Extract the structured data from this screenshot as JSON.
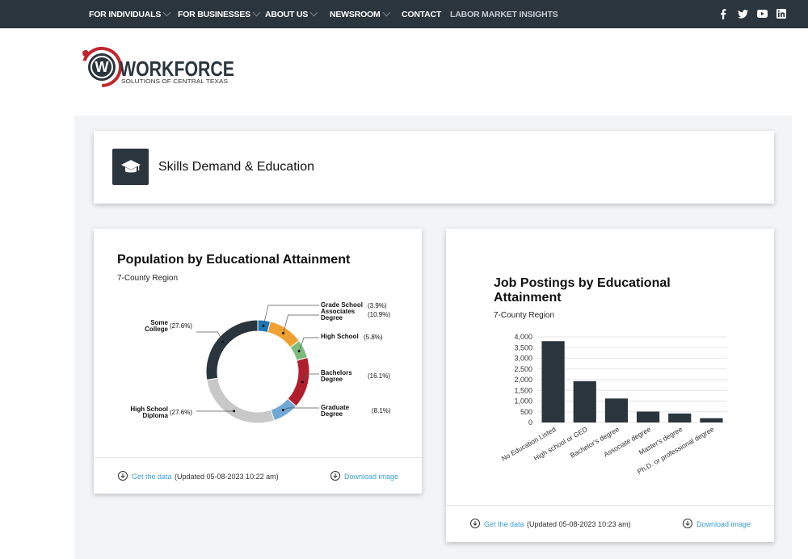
{
  "nav": {
    "items": [
      {
        "label": "FOR INDIVIDUALS",
        "has_dropdown": true
      },
      {
        "label": "FOR BUSINESSES",
        "has_dropdown": true
      },
      {
        "label": "ABOUT US",
        "has_dropdown": true
      },
      {
        "label": "NEWSROOM",
        "has_dropdown": true
      },
      {
        "label": "CONTACT",
        "has_dropdown": false
      },
      {
        "label": "LABOR MARKET INSIGHTS",
        "has_dropdown": false
      }
    ],
    "social_icons": [
      "facebook-icon",
      "twitter-icon",
      "youtube-icon",
      "linkedin-icon"
    ],
    "background": "#2b353d"
  },
  "logo": {
    "wordmark": "WORKFORCE",
    "tagline": "SOLUTIONS OF CENTRAL TEXAS",
    "accent_color": "#c1272d"
  },
  "section": {
    "title": "Skills Demand & Education",
    "icon": "graduation-cap-icon"
  },
  "population_chart": {
    "title": "Population by Educational Attainment",
    "subtitle": "7-County Region",
    "footer": {
      "get_data": "Get the data",
      "updated": "(Updated 05-08-2023 10:22 am)",
      "download": "Download image"
    }
  },
  "jobs_chart": {
    "title": "Job Postings by Educational Attainment",
    "subtitle": "7-County Region",
    "footer": {
      "get_data": "Get the data",
      "updated": "(Updated 05-08-2023 10:23 am)",
      "download": "Download image"
    }
  },
  "chart_data": [
    {
      "type": "pie",
      "style": "donut",
      "title": "Population by Educational Attainment",
      "subtitle": "7-County Region",
      "slices": [
        {
          "label": "Grade School",
          "value": 3.9,
          "display": "(3.9%)",
          "color": "#1f77b4"
        },
        {
          "label": "Associates Degree",
          "value": 10.9,
          "display": "(10.9%)",
          "color": "#f0a030"
        },
        {
          "label": "High School",
          "value": 5.8,
          "display": "(5.8%)",
          "color": "#7cbb7c"
        },
        {
          "label": "Bachelors Degree",
          "value": 16.1,
          "display": "(16.1%)",
          "color": "#b01e2c"
        },
        {
          "label": "Graduate Degree",
          "value": 8.1,
          "display": "(8.1%)",
          "color": "#6fa8d6"
        },
        {
          "label": "High School Diploma",
          "value": 27.6,
          "display": "(27.6%)",
          "color": "#c8c8c8"
        },
        {
          "label": "Some College",
          "value": 27.6,
          "display": "(27.6%)",
          "color": "#2b353d"
        }
      ]
    },
    {
      "type": "bar",
      "title": "Job Postings by Educational Attainment",
      "subtitle": "7-County Region",
      "categories": [
        "No Education Listed",
        "High school or GED",
        "Bachelor's degree",
        "Associate degree",
        "Master's degree",
        "Ph.D. or professional degree"
      ],
      "values": [
        3800,
        1930,
        1120,
        510,
        420,
        200
      ],
      "ylim": [
        0,
        4000
      ],
      "yticks": [
        "0",
        "500",
        "1,000",
        "1,500",
        "2,000",
        "2,500",
        "3,000",
        "3,500",
        "4,000"
      ],
      "bar_color": "#2b353d",
      "grid": true
    }
  ]
}
